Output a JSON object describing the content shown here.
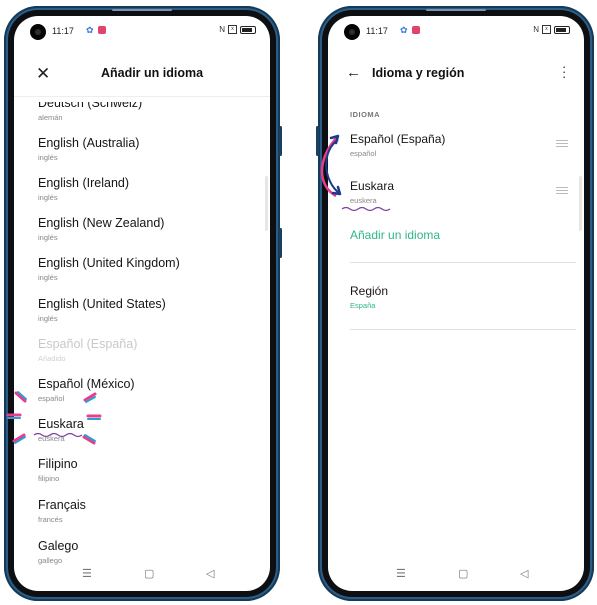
{
  "status": {
    "time": "11:17",
    "right_icons": [
      "N",
      "signal"
    ]
  },
  "left_screen": {
    "title": "Añadir un idioma",
    "languages": [
      {
        "name": "Deutsch (Schweiz)",
        "sub": "alemán",
        "disabled": false
      },
      {
        "name": "English (Australia)",
        "sub": "inglés",
        "disabled": false
      },
      {
        "name": "English (Ireland)",
        "sub": "inglés",
        "disabled": false
      },
      {
        "name": "English (New Zealand)",
        "sub": "inglés",
        "disabled": false
      },
      {
        "name": "English (United Kingdom)",
        "sub": "inglés",
        "disabled": false
      },
      {
        "name": "English (United States)",
        "sub": "inglés",
        "disabled": false
      },
      {
        "name": "Español (España)",
        "sub": "Añadido",
        "disabled": true
      },
      {
        "name": "Español (México)",
        "sub": "español",
        "disabled": false
      },
      {
        "name": "Euskara",
        "sub": "euskera",
        "disabled": false
      },
      {
        "name": "Filipino",
        "sub": "filipino",
        "disabled": false
      },
      {
        "name": "Français",
        "sub": "francés",
        "disabled": false
      },
      {
        "name": "Galego",
        "sub": "gallego",
        "disabled": false
      }
    ]
  },
  "right_screen": {
    "title": "Idioma y región",
    "section_label": "IDIOMA",
    "languages": [
      {
        "name": "Español (España)",
        "sub": "español"
      },
      {
        "name": "Euskara",
        "sub": "euskera"
      }
    ],
    "add_language": "Añadir un idioma",
    "region_title": "Región",
    "region_value": "España"
  },
  "nav": {
    "menu": "☰",
    "home": "▢",
    "back": "◁"
  },
  "colors": {
    "accent": "#2fb58a",
    "frame": "#2c5d86",
    "annotation_pink": "#e83e8c",
    "annotation_blue": "#2a9fd6",
    "annotation_navy": "#1e3a8a"
  }
}
